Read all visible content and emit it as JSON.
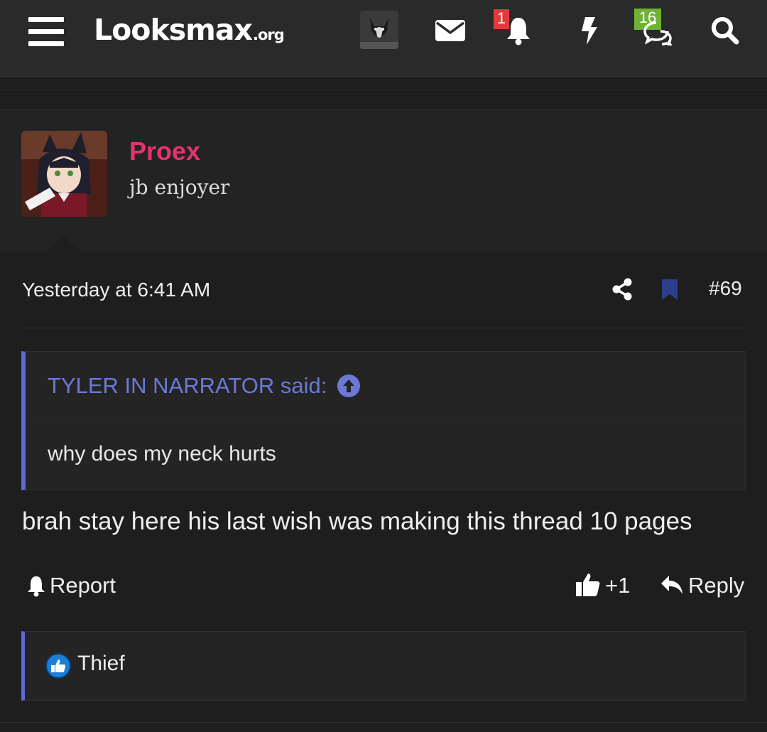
{
  "header": {
    "logo_main": "Looksmax",
    "logo_suffix": ".org",
    "notifications_count": "1",
    "conversations_count": "16",
    "icons": [
      "menu-icon",
      "user-avatar",
      "envelope-icon",
      "bell-icon",
      "bolt-icon",
      "conversations-icon",
      "search-icon"
    ]
  },
  "post": {
    "author": "Proex",
    "user_title": "jb enjoyer",
    "date": "Yesterday at 6:41 AM",
    "number": "#69",
    "quote": {
      "author": "TYLER IN NARRATOR said:",
      "text": "why does my neck hurts"
    },
    "body": "brah stay here his last wish was making this thread 10 pages",
    "actions": {
      "report": "Report",
      "like": "+1",
      "reply": "Reply"
    },
    "reactions": {
      "user": "Thief"
    }
  },
  "colors": {
    "username": "#e5336d",
    "quote_accent": "#5e6ad2",
    "badge_red": "#e03b3b",
    "badge_green": "#6fb234",
    "bookmark": "#2b3f8c"
  }
}
